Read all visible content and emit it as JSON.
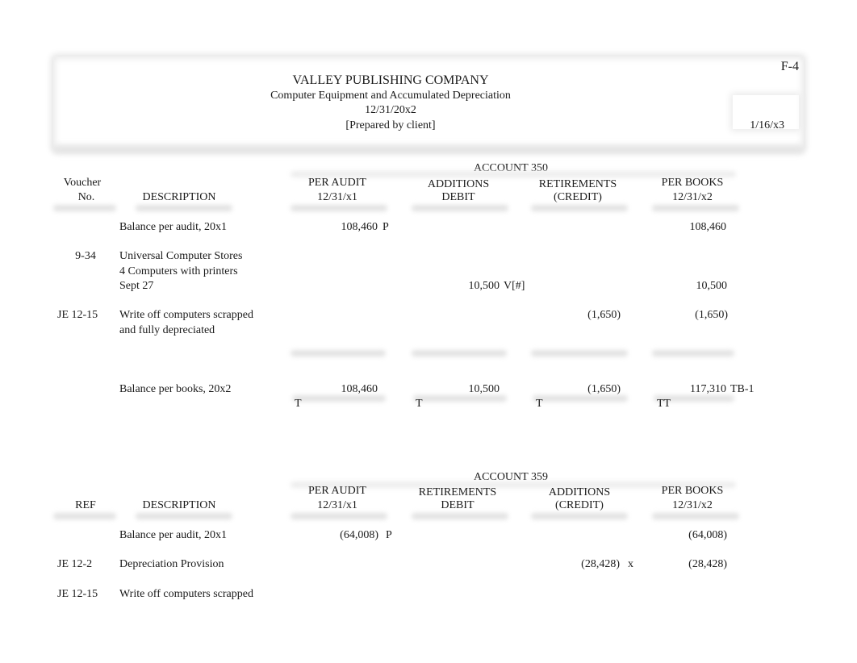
{
  "header": {
    "company": "VALLEY PUBLISHING COMPANY",
    "subtitle": "Computer Equipment and Accumulated Depreciation",
    "date": "12/31/20x2",
    "prepared_by": "[Prepared by client]",
    "reference": "F-4",
    "review_date": "1/16/x3"
  },
  "account350": {
    "title": "ACCOUNT 350",
    "columns": {
      "ref_line1": "Voucher",
      "ref_line2": "No.",
      "description": "DESCRIPTION",
      "per_audit_line1": "PER AUDIT",
      "per_audit_line2": "12/31/x1",
      "col3_line1": "ADDITIONS",
      "col3_line2": "DEBIT",
      "col4_line1": "RETIREMENTS",
      "col4_line2": "(CREDIT)",
      "per_books_line1": "PER BOOKS",
      "per_books_line2": "12/31/x2"
    },
    "rows": [
      {
        "ref": "",
        "description": [
          "Balance per audit, 20x1"
        ],
        "per_audit": "108,460",
        "per_audit_mark": "P",
        "col3": "",
        "col3_mark": "",
        "col4": "",
        "per_books": "108,460"
      },
      {
        "ref": "9-34",
        "description": [
          "Universal Computer Stores",
          "4 Computers with printers",
          "Sept 27"
        ],
        "per_audit": "",
        "per_audit_mark": "",
        "col3": "10,500",
        "col3_mark": "V[#]",
        "col4": "",
        "per_books": "10,500"
      },
      {
        "ref": "JE 12-15",
        "description": [
          "Write off computers scrapped",
          "and fully depreciated"
        ],
        "per_audit": "",
        "per_audit_mark": "",
        "col3": "",
        "col3_mark": "",
        "col4": "(1,650)",
        "per_books": "(1,650)"
      }
    ],
    "total": {
      "description": "Balance per books, 20x2",
      "per_audit": "108,460",
      "col3": "10,500",
      "col4": "(1,650)",
      "per_books": "117,310",
      "per_books_ref": "TB-1",
      "foot_marks": [
        "T",
        "T",
        "T",
        "TT"
      ]
    }
  },
  "account359": {
    "title": "ACCOUNT 359",
    "columns": {
      "ref": "REF",
      "description": "DESCRIPTION",
      "per_audit_line1": "PER AUDIT",
      "per_audit_line2": "12/31/x1",
      "col3_line1": "RETIREMENTS",
      "col3_line2": "DEBIT",
      "col4_line1": "ADDITIONS",
      "col4_line2": "(CREDIT)",
      "per_books_line1": "PER BOOKS",
      "per_books_line2": "12/31/x2"
    },
    "rows": [
      {
        "ref": "",
        "description": "Balance per audit, 20x1",
        "per_audit": "(64,008)",
        "per_audit_mark": "P",
        "col4": "",
        "col4_mark": "",
        "per_books": "(64,008)"
      },
      {
        "ref": "JE 12-2",
        "description": "Depreciation Provision",
        "per_audit": "",
        "per_audit_mark": "",
        "col4": "(28,428)",
        "col4_mark": "x",
        "per_books": "(28,428)"
      },
      {
        "ref": "JE 12-15",
        "description": "Write off computers scrapped",
        "per_audit": "",
        "per_audit_mark": "",
        "col4": "",
        "col4_mark": "",
        "per_books": ""
      }
    ]
  }
}
